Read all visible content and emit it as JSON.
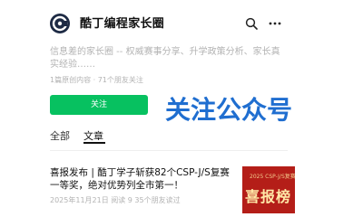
{
  "account": {
    "name": "酷丁编程家长圈",
    "bio": "信息差的家长圈 -- 权威赛事分享、升学政策分析、家长真实经验……",
    "stats": "1篇原创内容 · 71个朋友关注",
    "follow_label": "关注"
  },
  "tabs": [
    {
      "label": "全部",
      "active": false
    },
    {
      "label": "文章",
      "active": true
    }
  ],
  "banner": {
    "text": "关注公众号"
  },
  "article": {
    "title": "喜报发布 | 酷丁学子斩获82个CSP-J/S复赛一等奖，绝对优势列全市第一！",
    "meta": "2025年11月21日  阅读 9  35个朋友读过",
    "thumbnail": {
      "year_text": "2025 CSP-J/S复赛",
      "word": "喜报榜"
    }
  },
  "colors": {
    "accent": "#07c160",
    "banner_fill": "#1f6ed0",
    "thumbnail_fill": "#b41e18"
  }
}
